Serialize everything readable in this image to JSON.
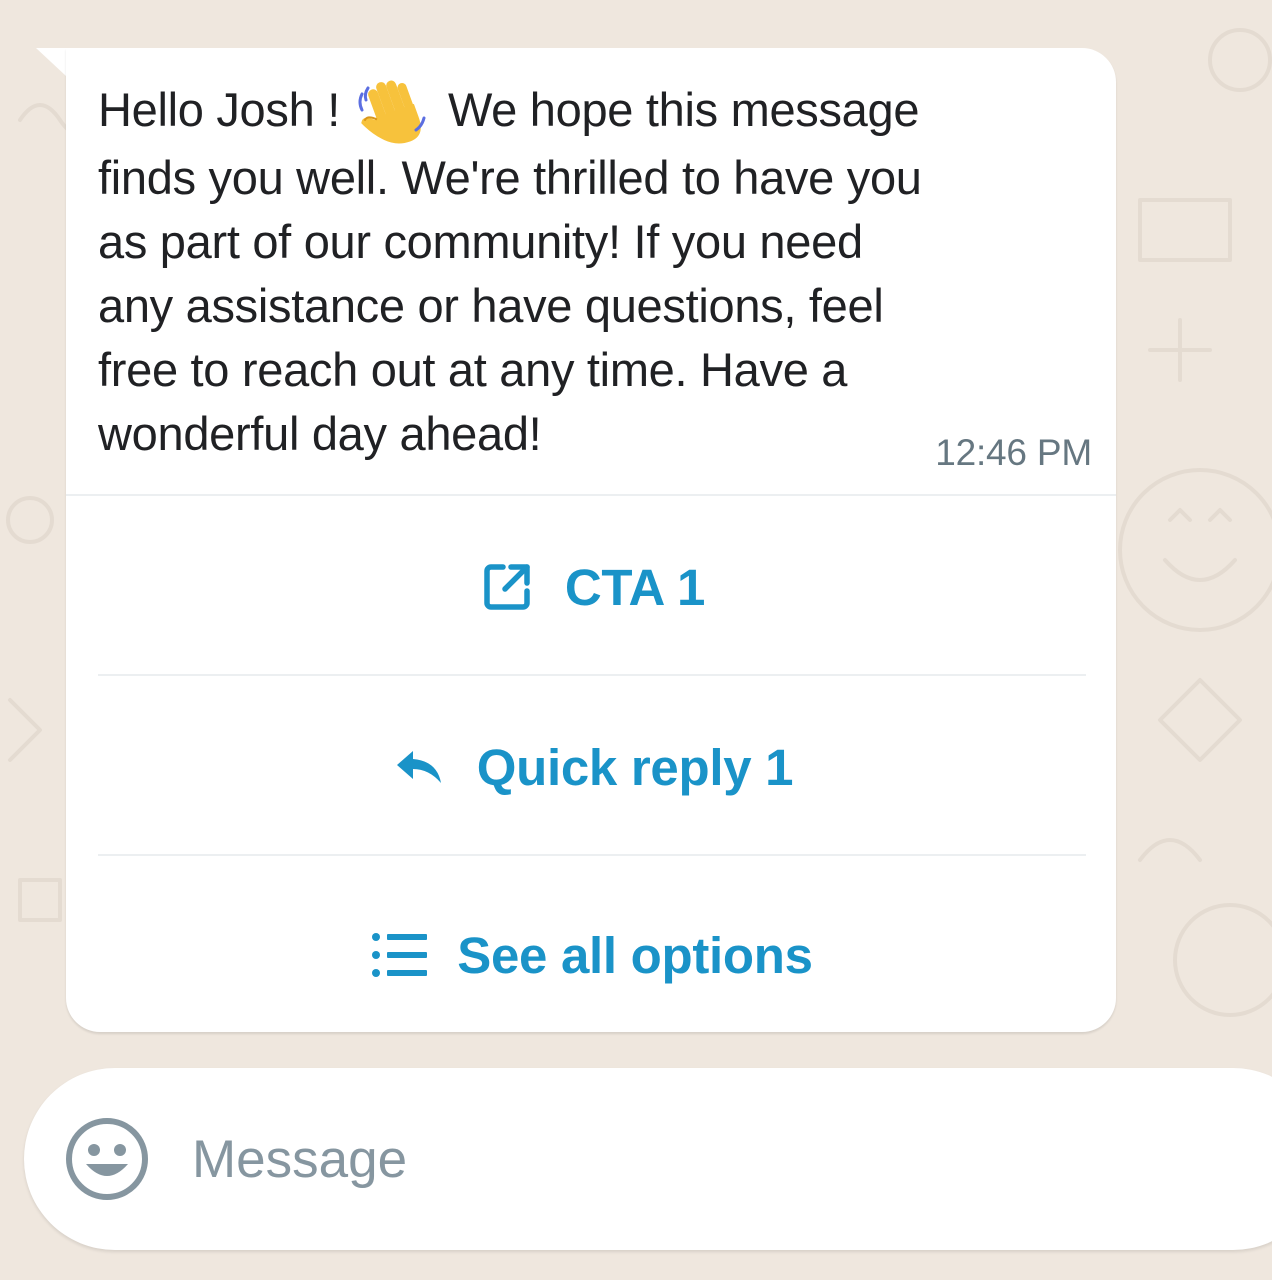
{
  "message": {
    "lines": [
      "Hello Josh !",
      "We hope this message",
      "finds you well. We're thrilled to have you",
      "as part of our community! If you need",
      "any assistance or have questions, feel",
      "free to reach out at any time. Have a",
      "wonderful day ahead!"
    ],
    "emoji": "waving-hand-icon",
    "timestamp": "12:46 PM"
  },
  "actions": [
    {
      "label": "CTA 1",
      "icon": "external-link-icon"
    },
    {
      "label": "Quick reply 1",
      "icon": "reply-arrow-icon"
    },
    {
      "label": "See all options",
      "icon": "list-icon"
    }
  ],
  "composer": {
    "placeholder": "Message",
    "value": "",
    "icon": "smiley-emoji-icon"
  },
  "colors": {
    "background": "#efe7de",
    "bubble": "#ffffff",
    "text": "#202124",
    "timestamp": "#667781",
    "accent": "#1a93c8",
    "placeholder": "#8696a0"
  }
}
